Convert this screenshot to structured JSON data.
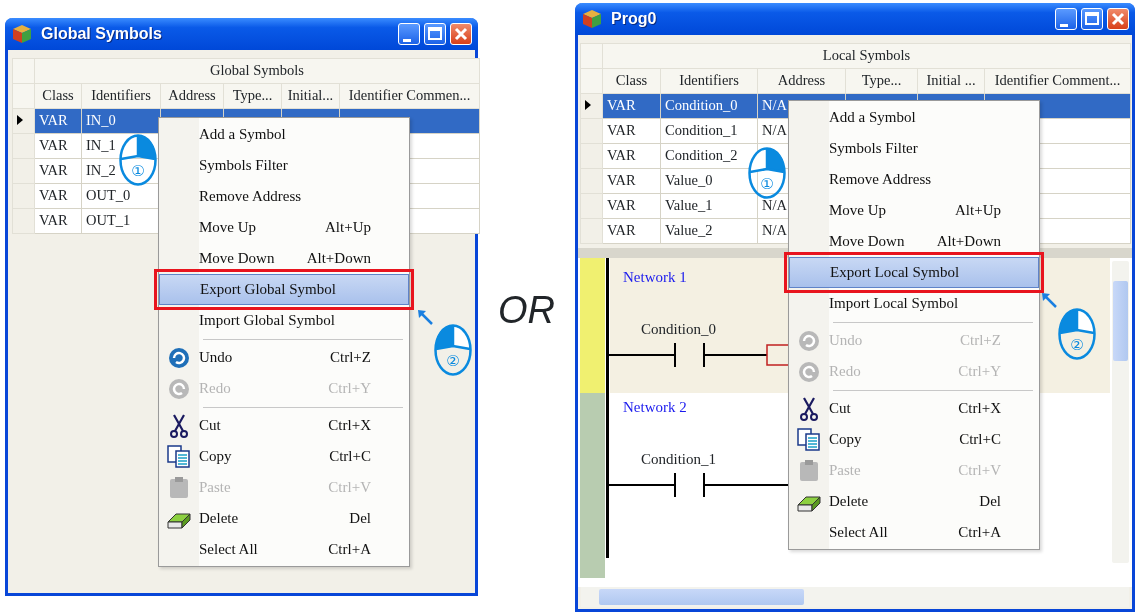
{
  "panels": [
    {
      "title": "Global Symbols",
      "table": {
        "caption": "Global Symbols",
        "columns": [
          "Class",
          "Identifiers",
          "Address",
          "Type...",
          "Initial...",
          "Identifier Commen..."
        ],
        "rows": [
          {
            "selected": true,
            "cells": [
              "VAR",
              "IN_0"
            ]
          },
          {
            "selected": false,
            "cells": [
              "VAR",
              "IN_1"
            ]
          },
          {
            "selected": false,
            "cells": [
              "VAR",
              "IN_2"
            ]
          },
          {
            "selected": false,
            "cells": [
              "VAR",
              "OUT_0"
            ]
          },
          {
            "selected": false,
            "cells": [
              "VAR",
              "OUT_1"
            ]
          }
        ]
      },
      "menu": {
        "items": [
          {
            "kind": "plain",
            "label": "Add a Symbol",
            "selected": false,
            "disabled": false
          },
          {
            "kind": "plain",
            "label": "Symbols Filter",
            "selected": false,
            "disabled": false
          },
          {
            "kind": "plain",
            "label": "Remove Address",
            "selected": false,
            "disabled": false
          },
          {
            "kind": "plain",
            "label": "Move Up",
            "shortcut": "Alt+Up",
            "selected": false,
            "disabled": false
          },
          {
            "kind": "plain",
            "label": "Move Down",
            "shortcut": "Alt+Down",
            "selected": false,
            "disabled": false
          },
          {
            "kind": "plain",
            "label": "Export Global Symbol",
            "selected": true,
            "disabled": false
          },
          {
            "kind": "plain",
            "label": "Import Global Symbol",
            "selected": false,
            "disabled": false
          },
          {
            "kind": "separator"
          },
          {
            "kind": "undo",
            "label": "Undo",
            "shortcut": "Ctrl+Z",
            "selected": false,
            "disabled": false
          },
          {
            "kind": "redo",
            "label": "Redo",
            "shortcut": "Ctrl+Y",
            "selected": false,
            "disabled": true
          },
          {
            "kind": "separator"
          },
          {
            "kind": "cut",
            "label": "Cut",
            "shortcut": "Ctrl+X",
            "selected": false,
            "disabled": false
          },
          {
            "kind": "copy",
            "label": "Copy",
            "shortcut": "Ctrl+C",
            "selected": false,
            "disabled": false
          },
          {
            "kind": "paste",
            "label": "Paste",
            "shortcut": "Ctrl+V",
            "selected": false,
            "disabled": true
          },
          {
            "kind": "delete",
            "label": "Delete",
            "shortcut": "Del",
            "selected": false,
            "disabled": false
          },
          {
            "kind": "plain",
            "label": "Select All",
            "shortcut": "Ctrl+A",
            "selected": false,
            "disabled": false
          }
        ]
      },
      "callouts": [
        {
          "step": "①",
          "right_click": true,
          "pointer": false
        },
        {
          "step": "②",
          "right_click": false,
          "pointer": true
        }
      ]
    },
    {
      "title": "Prog0",
      "table": {
        "caption": "Local Symbols",
        "columns": [
          "Class",
          "Identifiers",
          "Address",
          "Type...",
          "Initial ...",
          "Identifier Comment..."
        ],
        "rows": [
          {
            "selected": true,
            "cells": [
              "VAR",
              "Condition_0",
              "N/A"
            ]
          },
          {
            "selected": false,
            "cells": [
              "VAR",
              "Condition_1",
              "N/A"
            ]
          },
          {
            "selected": false,
            "cells": [
              "VAR",
              "Condition_2"
            ]
          },
          {
            "selected": false,
            "cells": [
              "VAR",
              "Value_0"
            ]
          },
          {
            "selected": false,
            "cells": [
              "VAR",
              "Value_1",
              "N/A"
            ]
          },
          {
            "selected": false,
            "cells": [
              "VAR",
              "Value_2",
              "N/A"
            ]
          }
        ]
      },
      "ladder": {
        "networks": [
          {
            "label": "Network 1",
            "contact": "Condition_0"
          },
          {
            "label": "Network 2",
            "contact": "Condition_1"
          }
        ]
      },
      "menu": {
        "items": [
          {
            "kind": "plain",
            "label": "Add a Symbol",
            "selected": false,
            "disabled": false
          },
          {
            "kind": "plain",
            "label": "Symbols Filter",
            "selected": false,
            "disabled": false
          },
          {
            "kind": "plain",
            "label": "Remove Address",
            "selected": false,
            "disabled": false
          },
          {
            "kind": "plain",
            "label": "Move Up",
            "shortcut": "Alt+Up",
            "selected": false,
            "disabled": false
          },
          {
            "kind": "plain",
            "label": "Move Down",
            "shortcut": "Alt+Down",
            "selected": false,
            "disabled": false
          },
          {
            "kind": "plain",
            "label": "Export Local Symbol",
            "selected": true,
            "disabled": false
          },
          {
            "kind": "plain",
            "label": "Import Local Symbol",
            "selected": false,
            "disabled": false
          },
          {
            "kind": "separator"
          },
          {
            "kind": "undo",
            "label": "Undo",
            "shortcut": "Ctrl+Z",
            "selected": false,
            "disabled": true
          },
          {
            "kind": "redo",
            "label": "Redo",
            "shortcut": "Ctrl+Y",
            "selected": false,
            "disabled": true
          },
          {
            "kind": "separator"
          },
          {
            "kind": "cut",
            "label": "Cut",
            "shortcut": "Ctrl+X",
            "selected": false,
            "disabled": false
          },
          {
            "kind": "copy",
            "label": "Copy",
            "shortcut": "Ctrl+C",
            "selected": false,
            "disabled": false
          },
          {
            "kind": "paste",
            "label": "Paste",
            "shortcut": "Ctrl+V",
            "selected": false,
            "disabled": true
          },
          {
            "kind": "delete",
            "label": "Delete",
            "shortcut": "Del",
            "selected": false,
            "disabled": false
          },
          {
            "kind": "plain",
            "label": "Select All",
            "shortcut": "Ctrl+A",
            "selected": false,
            "disabled": false
          }
        ]
      },
      "callouts": [
        {
          "step": "①",
          "right_click": true,
          "pointer": false
        },
        {
          "step": "②",
          "right_click": false,
          "pointer": true
        }
      ]
    }
  ],
  "divider_text": "OR"
}
